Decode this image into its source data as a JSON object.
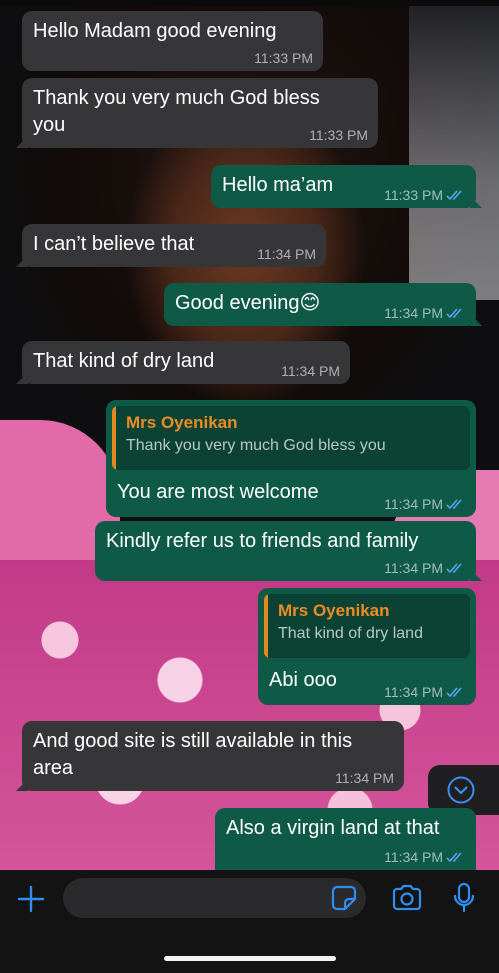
{
  "messages": [
    {
      "text": "Hello Madam good evening",
      "time": "11:33 PM"
    },
    {
      "text_line1": "Thank you very much God bless",
      "text_line2": "you",
      "time": "11:33 PM"
    },
    {
      "text": "Hello ma’am",
      "time": "11:33 PM"
    },
    {
      "text": "I can’t believe that",
      "time": "11:34 PM"
    },
    {
      "text": "Good evening😊",
      "time": "11:34 PM"
    },
    {
      "text": "That kind of dry land",
      "time": "11:34 PM"
    },
    {
      "quote_name": "Mrs Oyenikan",
      "quote_text": "Thank you very much God bless you",
      "text": "You are most welcome",
      "time": "11:34 PM"
    },
    {
      "text": "Kindly refer us to friends and family",
      "time": "11:34 PM"
    },
    {
      "quote_name": "Mrs Oyenikan",
      "quote_text": "That kind of dry land",
      "text": "Abi ooo",
      "time": "11:34 PM"
    },
    {
      "text_line1": "And good site is still available in this",
      "text_line2": "area",
      "time": "11:34 PM"
    },
    {
      "text": "Also a virgin land at that",
      "time": "11:34 PM"
    }
  ],
  "input": {
    "placeholder": ""
  },
  "icons": {
    "add": "plus-icon",
    "sticker": "sticker-icon",
    "camera": "camera-icon",
    "mic": "microphone-icon",
    "scroll": "chevron-down-circle-icon",
    "read": "double-check-icon"
  },
  "colors": {
    "incoming": "#363638",
    "outgoing": "#0f5a47",
    "quote_name": "#eb8c25",
    "accent": "#2f8ff0",
    "read_ticks": "#53a6f5"
  }
}
